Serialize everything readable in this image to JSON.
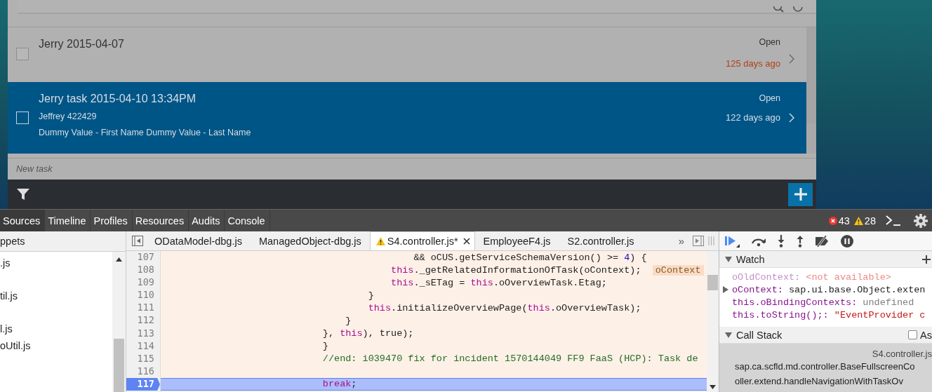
{
  "task_app": {
    "tasks": [
      {
        "title": "Jerry 2015-04-07",
        "status": "Open",
        "age": "125 days ago",
        "overdue": true,
        "selected": false,
        "checked": false
      },
      {
        "title": "Jerry task 2015-04-10 13:34PM",
        "details": [
          "Jeffrey 422429",
          "Dummy Value - First Name Dummy Value - Last Name"
        ],
        "status": "Open",
        "age": "122 days ago",
        "overdue": false,
        "selected": true,
        "checked": false
      }
    ],
    "new_task": {
      "placeholder": "New task"
    }
  },
  "devtools": {
    "panels": [
      {
        "label": "Sources",
        "selected": true
      },
      {
        "label": "Timeline",
        "selected": false
      },
      {
        "label": "Profiles",
        "selected": false
      },
      {
        "label": "Resources",
        "selected": false
      },
      {
        "label": "Audits",
        "selected": false
      },
      {
        "label": "Console",
        "selected": false
      }
    ],
    "errors": "43",
    "warnings": "28",
    "navigator": {
      "tab": "ppets",
      "files": [
        ".js",
        "til.js",
        "l.js",
        "oUtil.js"
      ]
    },
    "file_tabs": [
      {
        "label": "ODataModel-dbg.js",
        "selected": false,
        "modified_warning": false
      },
      {
        "label": "ManagedObject-dbg.js",
        "selected": false,
        "modified_warning": false
      },
      {
        "label": "S4.controller.js*",
        "selected": true,
        "modified_warning": true
      },
      {
        "label": "EmployeeF4.js",
        "selected": false,
        "modified_warning": false
      },
      {
        "label": "S2.controller.js",
        "selected": false,
        "modified_warning": false
      }
    ],
    "more_tabs": "»",
    "code": [
      {
        "number": "107",
        "current": false,
        "tokens": [
          {
            "kind": "plain",
            "text": "                                            && oCUS.getServiceSchemaVersion() >= "
          },
          {
            "kind": "number",
            "text": "4"
          },
          {
            "kind": "plain",
            "text": ") {"
          }
        ]
      },
      {
        "number": "108",
        "current": false,
        "tokens": [
          {
            "kind": "keyword",
            "text": "                                        this"
          },
          {
            "kind": "plain",
            "text": "._getRelatedInformationOfTask(oContext);"
          }
        ],
        "inline_value": "oContext"
      },
      {
        "number": "109",
        "current": false,
        "tokens": [
          {
            "kind": "keyword",
            "text": "                                        this"
          },
          {
            "kind": "plain",
            "text": "._sETag = "
          },
          {
            "kind": "keyword",
            "text": "this"
          },
          {
            "kind": "plain",
            "text": ".oOverviewTask.Etag;"
          }
        ]
      },
      {
        "number": "110",
        "current": false,
        "tokens": [
          {
            "kind": "plain",
            "text": "                                    }"
          }
        ]
      },
      {
        "number": "111",
        "current": false,
        "tokens": [
          {
            "kind": "keyword",
            "text": "                                    this"
          },
          {
            "kind": "plain",
            "text": ".initializeOverviewPage("
          },
          {
            "kind": "keyword",
            "text": "this"
          },
          {
            "kind": "plain",
            "text": ".oOverviewTask);"
          }
        ]
      },
      {
        "number": "112",
        "current": false,
        "tokens": [
          {
            "kind": "plain",
            "text": "                                }"
          }
        ]
      },
      {
        "number": "113",
        "current": false,
        "tokens": [
          {
            "kind": "plain",
            "text": "                            }, "
          },
          {
            "kind": "keyword",
            "text": "this"
          },
          {
            "kind": "plain",
            "text": "), true);"
          }
        ]
      },
      {
        "number": "114",
        "current": false,
        "tokens": [
          {
            "kind": "plain",
            "text": "                            }"
          }
        ]
      },
      {
        "number": "115",
        "current": false,
        "tokens": [
          {
            "kind": "comment",
            "text": "                            //end: i039470 fix for incident 1570144049 FF9 FaaS (HCP): Task de"
          }
        ]
      },
      {
        "number": "116",
        "current": false
      },
      {
        "number": "117",
        "current": true,
        "tokens": [
          {
            "kind": "keyword",
            "text": "                            break"
          },
          {
            "kind": "plain",
            "text": ";"
          }
        ]
      }
    ],
    "watch": {
      "title": "Watch",
      "items": [
        {
          "name": "oOldContext:",
          "value": "<not available>",
          "kind": "unavailable",
          "expandable": false
        },
        {
          "name": "oContext:",
          "value": "sap.ui.base.Object.exten",
          "kind": "object",
          "expandable": true
        },
        {
          "name": "this.oBindingContexts:",
          "value": "undefined",
          "kind": "undefined",
          "expandable": false
        },
        {
          "name": "this.toString();:",
          "value": "\"EventProvider c",
          "kind": "string",
          "expandable": false
        }
      ]
    },
    "call_stack": {
      "title": "Call Stack",
      "async_label": "As",
      "async_checked": false,
      "frames": [
        {
          "location": "S4.controller.js",
          "name_lines": [
            "sap.ca.scfld.md.controller.BaseFullscreenCo",
            "oller.extend.handleNavigationWithTaskOv"
          ],
          "selected": true
        }
      ]
    }
  }
}
